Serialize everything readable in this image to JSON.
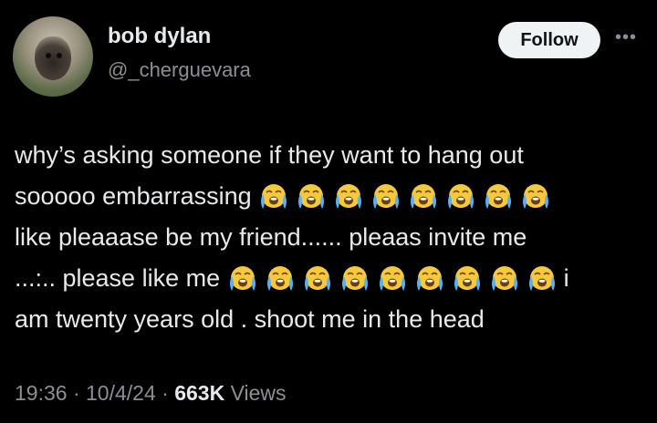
{
  "user": {
    "name": "bob dylan",
    "handle": "@_cherguevara"
  },
  "actions": {
    "follow_label": "Follow",
    "more_icon": "more-horizontal-icon"
  },
  "tweet": {
    "line1": "why’s asking someone if they want to hang out",
    "line2_text": "sooooo embarrassing",
    "line2_emoji_count": 8,
    "line3": "like pleaaase be my friend...... pleaas invite me",
    "line4_text": "...:.. please like me",
    "line4_emoji_count": 9,
    "line4_tail": "i",
    "line5": "am twenty years old . shoot me in the head",
    "emoji": "loudly-crying-face-icon"
  },
  "meta": {
    "time": "19:36",
    "sep1": "·",
    "date": "10/4/24",
    "sep2": "·",
    "views_count": "663K",
    "views_label": "Views"
  },
  "colors": {
    "background": "#000000",
    "text": "#e7e9ea",
    "muted": "#8b8f93",
    "follow_bg": "#eff3f4"
  }
}
